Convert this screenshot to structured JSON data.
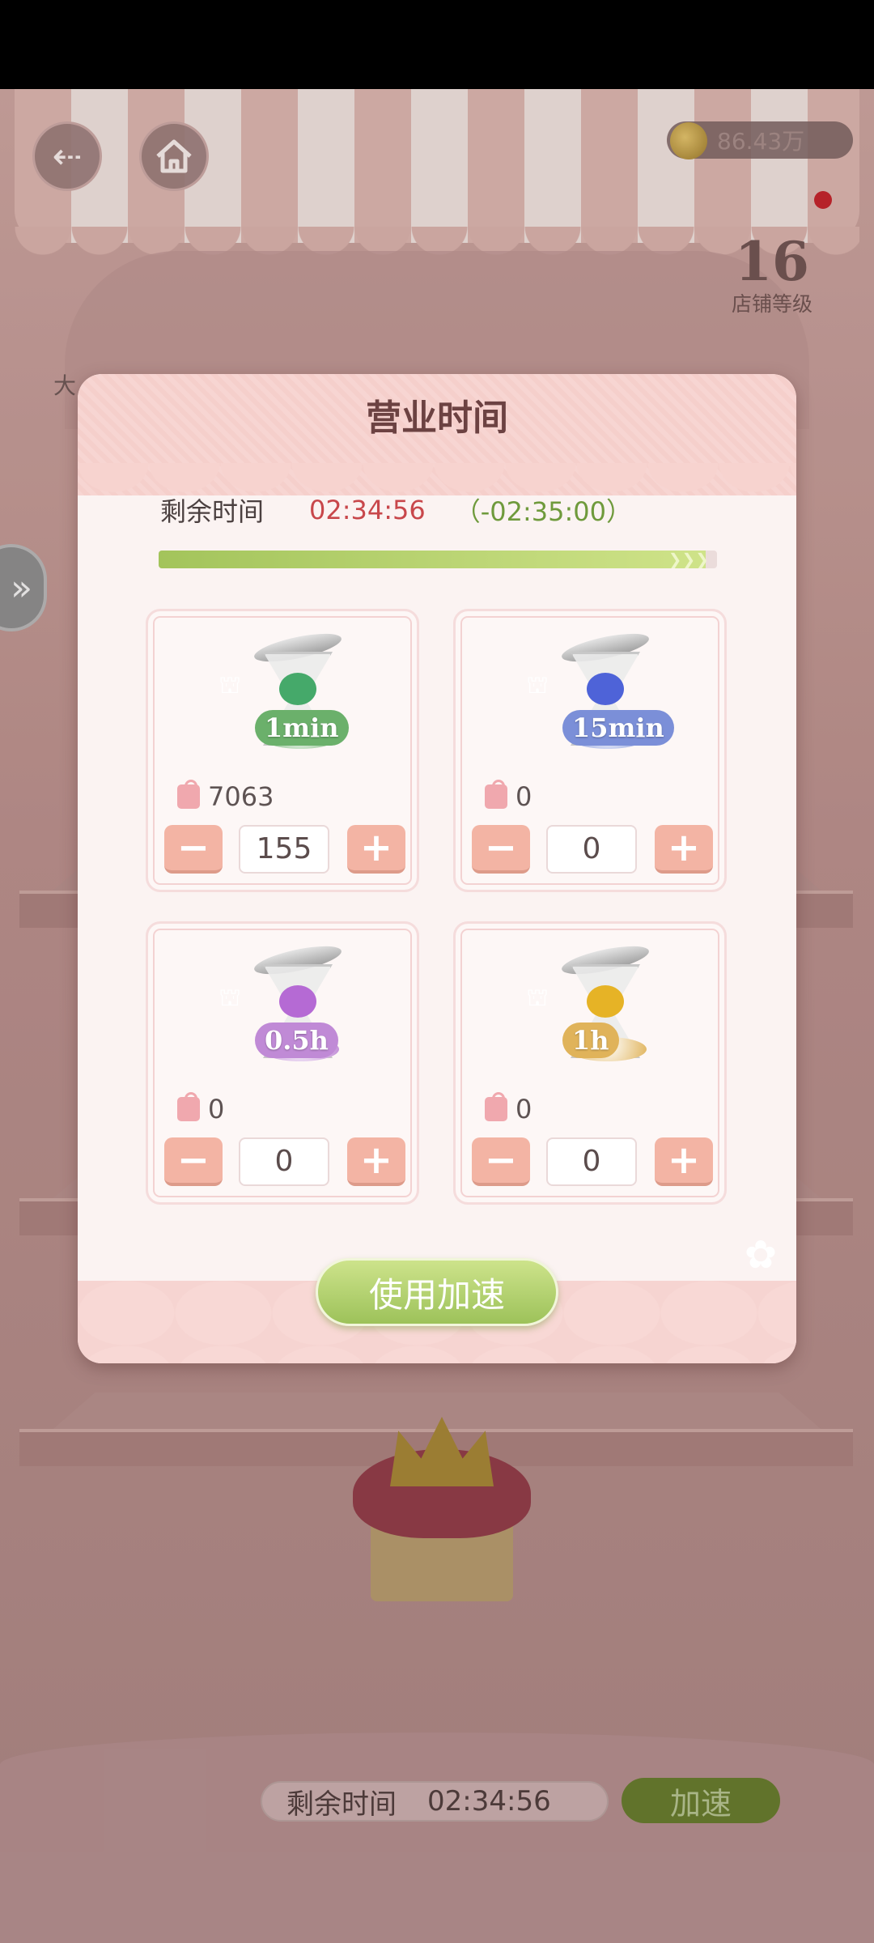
{
  "header": {
    "coins": "86.43万",
    "shop_level": "16",
    "shop_level_label": "店铺等级",
    "background_note": "大"
  },
  "modal": {
    "title": "营业时间",
    "remaining_label": "剩余时间",
    "remaining_value": "02:34:56",
    "remaining_delta": "（-02:35:00）",
    "progress": 0.98,
    "progress_arrows": "❯❯❯",
    "items": [
      {
        "tag": "1min",
        "owned": "7063",
        "quantity": "155",
        "color": "#6bb06b",
        "sand": "#45a96a"
      },
      {
        "tag": "15min",
        "owned": "0",
        "quantity": "0",
        "color": "#7b8fd8",
        "sand": "#4e63d8"
      },
      {
        "tag": "0.5h",
        "owned": "0",
        "quantity": "0",
        "color": "#c08ad6",
        "sand": "#b56ad4"
      },
      {
        "tag": "1h",
        "owned": "0",
        "quantity": "0",
        "color": "#e0b35a",
        "sand": "#e6b326"
      }
    ],
    "minus_symbol": "−",
    "plus_symbol": "+",
    "use_button": "使用加速"
  },
  "bottom_bar": {
    "remaining_label": "剩余时间",
    "remaining_value": "02:34:56",
    "speed_button": "加速"
  },
  "icons": {
    "back": "arrow-left-icon",
    "home": "home-icon",
    "coin": "coin-icon",
    "side": "double-chevron-right-icon"
  }
}
